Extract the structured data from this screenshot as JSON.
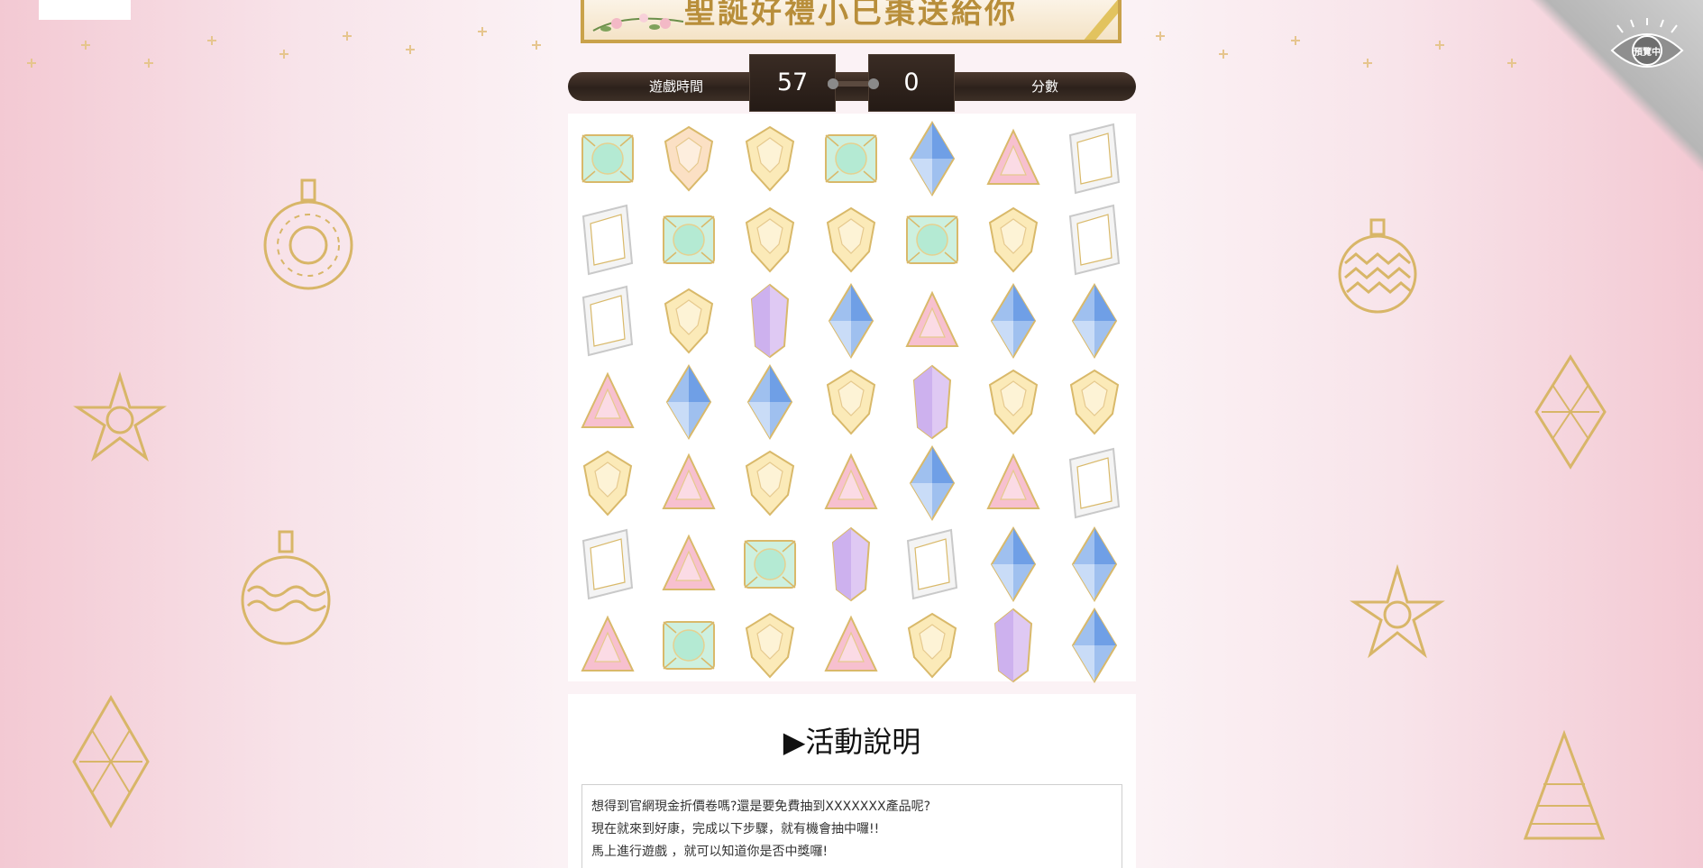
{
  "preview_badge": "預覽中",
  "banner": {
    "title": "聖誕好禮小巳棗送給你"
  },
  "scorebar": {
    "time_label": "遊戲時間",
    "time_value": "57",
    "score_value": "0",
    "score_label": "分數"
  },
  "board": {
    "rows": [
      [
        "green-square-gem",
        "peach-hexagon-gem",
        "yellow-hexagon-gem",
        "green-square-gem",
        "blue-diamond-gem",
        "pink-triangle-gem",
        "white-rhombus-gem"
      ],
      [
        "white-rhombus-gem",
        "green-square-gem",
        "yellow-hexagon-gem",
        "yellow-hexagon-gem",
        "green-square-gem",
        "yellow-hexagon-gem",
        "white-rhombus-gem"
      ],
      [
        "white-rhombus-gem",
        "yellow-hexagon-gem",
        "purple-crystal-gem",
        "blue-diamond-gem",
        "pink-triangle-gem",
        "blue-diamond-gem",
        "blue-diamond-gem"
      ],
      [
        "pink-triangle-gem",
        "blue-diamond-gem",
        "blue-diamond-gem",
        "yellow-hexagon-gem",
        "purple-crystal-gem",
        "yellow-hexagon-gem",
        "yellow-hexagon-gem"
      ],
      [
        "yellow-hexagon-gem",
        "pink-triangle-gem",
        "yellow-hexagon-gem",
        "pink-triangle-gem",
        "blue-diamond-gem",
        "pink-triangle-gem",
        "white-rhombus-gem"
      ],
      [
        "white-rhombus-gem",
        "pink-triangle-gem",
        "green-square-gem",
        "purple-crystal-gem",
        "white-rhombus-gem",
        "blue-diamond-gem",
        "blue-diamond-gem"
      ],
      [
        "pink-triangle-gem",
        "green-square-gem",
        "yellow-hexagon-gem",
        "pink-triangle-gem",
        "yellow-hexagon-gem",
        "purple-crystal-gem",
        "blue-diamond-gem"
      ]
    ]
  },
  "info": {
    "title": "▶活動說明",
    "lines": [
      "想得到官網現金折價卷嗎?還是要免費抽到XXXXXXX產品呢?",
      "現在就來到好康，完成以下步驟，就有機會抽中囉!!",
      "馬上進行遊戲 ，就可以知道你是否中獎囉!"
    ]
  },
  "colors": {
    "gold": "#c9a24a",
    "wood_dark": "#2c211b",
    "pink_background": "#f3c9d3",
    "text": "#111111"
  }
}
